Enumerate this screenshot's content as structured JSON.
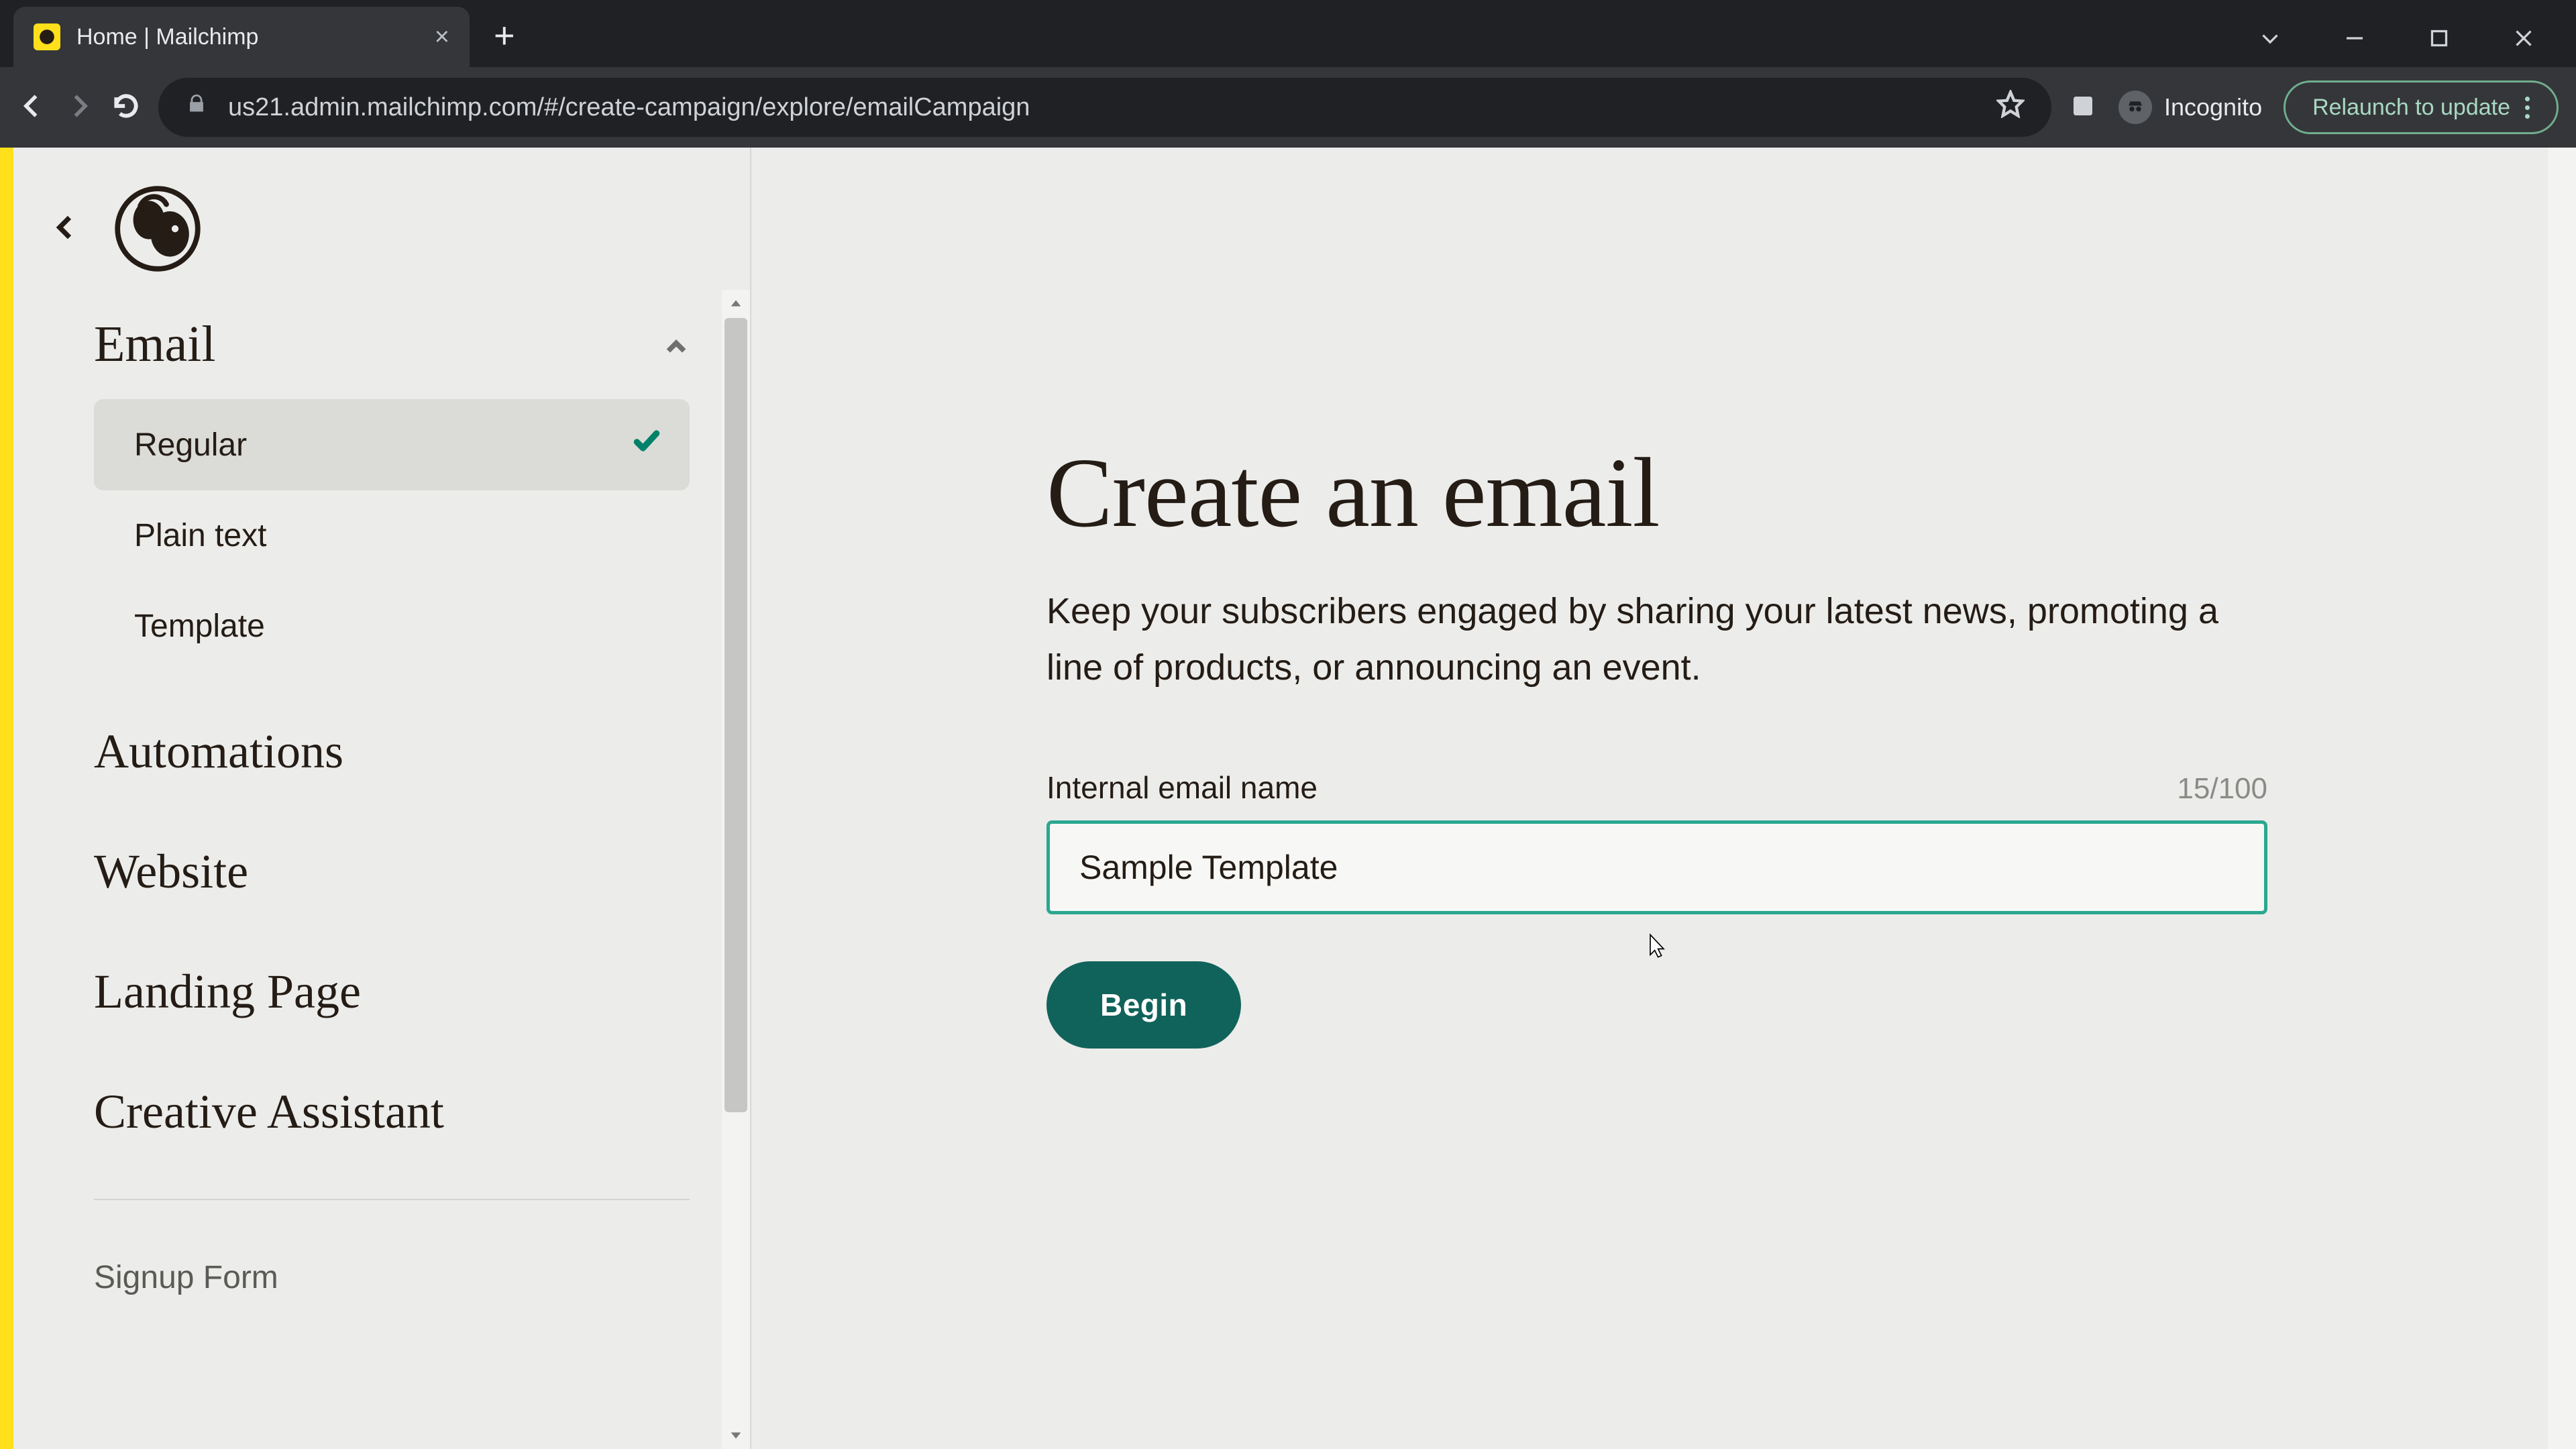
{
  "browser": {
    "tab_title": "Home | Mailchimp",
    "url": "us21.admin.mailchimp.com/#/create-campaign/explore/emailCampaign",
    "incognito_label": "Incognito",
    "relaunch_label": "Relaunch to update"
  },
  "sidebar": {
    "groups": [
      {
        "label": "Email",
        "expanded": true,
        "items": [
          {
            "label": "Regular",
            "selected": true
          },
          {
            "label": "Plain text",
            "selected": false
          },
          {
            "label": "Template",
            "selected": false
          }
        ]
      },
      {
        "label": "Automations",
        "expanded": false,
        "items": []
      },
      {
        "label": "Website",
        "expanded": false,
        "chevron": true,
        "items": []
      },
      {
        "label": "Landing Page",
        "expanded": false,
        "items": []
      },
      {
        "label": "Creative Assistant",
        "expanded": false,
        "items": []
      }
    ],
    "footer_link": {
      "label": "Signup Form"
    }
  },
  "main": {
    "title": "Create an email",
    "subtitle": "Keep your subscribers engaged by sharing your latest news, promoting a line of products, or announcing an event.",
    "field_label": "Internal email name",
    "char_count": "15/100",
    "input_value": "Sample Template",
    "begin_label": "Begin"
  }
}
